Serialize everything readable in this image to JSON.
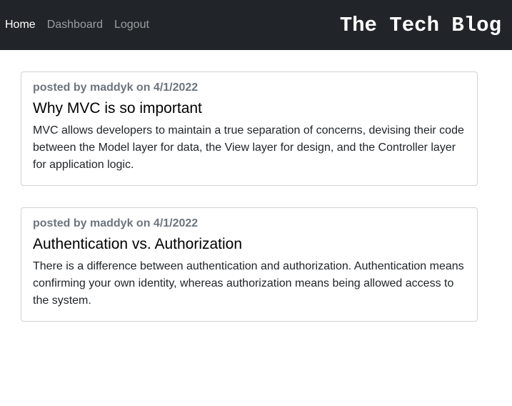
{
  "nav": {
    "links": [
      {
        "label": "Home",
        "active": true
      },
      {
        "label": "Dashboard",
        "active": false
      },
      {
        "label": "Logout",
        "active": false
      }
    ],
    "brand": "The Tech Blog"
  },
  "posts": [
    {
      "meta": "posted by maddyk on 4/1/2022",
      "title": "Why MVC is so important",
      "body": "MVC allows developers to maintain a true separation of concerns, devising their code between the Model layer for data, the View layer for design, and the Controller layer for application logic."
    },
    {
      "meta": "posted by maddyk on 4/1/2022",
      "title": "Authentication vs. Authorization",
      "body": "There is a difference between authentication and authorization. Authentication means confirming your own identity, whereas authorization means being allowed access to the system."
    }
  ],
  "colors": {
    "navbar_bg": "#212529",
    "meta_text": "#6c757d",
    "card_border": "#dee2e6"
  }
}
